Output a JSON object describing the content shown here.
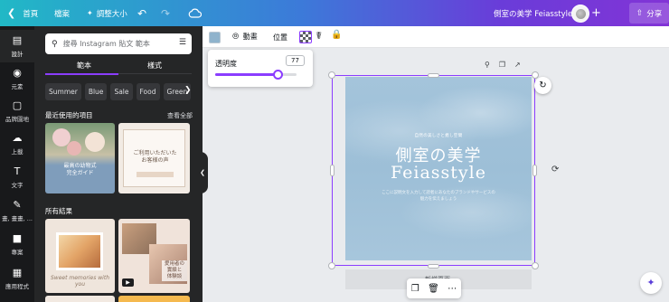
{
  "topbar": {
    "back_label": "首頁",
    "file_label": "檔案",
    "resize_label": "調整大小",
    "title": "側室の美学 Feiasstyle",
    "share_label": "分享"
  },
  "rail": {
    "items": [
      {
        "label": "設計",
        "icon": "layout-icon"
      },
      {
        "label": "元素",
        "icon": "shapes-icon"
      },
      {
        "label": "品牌園地",
        "icon": "brand-icon"
      },
      {
        "label": "上載",
        "icon": "upload-icon"
      },
      {
        "label": "文字",
        "icon": "text-icon"
      },
      {
        "label": "畫, 畫畫, ...",
        "icon": "draw-icon"
      },
      {
        "label": "專案",
        "icon": "folder-icon"
      },
      {
        "label": "應用程式",
        "icon": "apps-icon"
      }
    ]
  },
  "panel": {
    "search_placeholder": "搜尋 Instagram 貼文 範本",
    "tabs": [
      "範本",
      "樣式"
    ],
    "chips": [
      "Summer",
      "Blue",
      "Sale",
      "Food",
      "Green"
    ],
    "recent_label": "最近使用的項目",
    "see_all": "查看全部",
    "results_label": "所有結果",
    "thumb1_text": "最高の幼物式\n完全ガイド",
    "thumb2_text": "ご利用いただいた\nお客様の声",
    "thumb3_text": "Sweet memories with you",
    "thumb4_text": "愛用者の\n實績と\n体験談"
  },
  "context": {
    "animate_label": "動畫",
    "position_label": "位置"
  },
  "transparency": {
    "label": "透明度",
    "value": "77",
    "level": 0.77
  },
  "page": {
    "small_caption": "自然の美しさと癒し空間",
    "title": "側室の美学",
    "brand": "Feiasstyle",
    "description": "ここに説明文を入力して読者にあなたのブランドやサービスの魅力を伝えましょう",
    "below_label": "新增頁面"
  },
  "colors": {
    "accent": "#8b3dff",
    "page_bg": "#9dbfd7",
    "rail_bg": "#18191b",
    "panel_bg": "#252627"
  }
}
